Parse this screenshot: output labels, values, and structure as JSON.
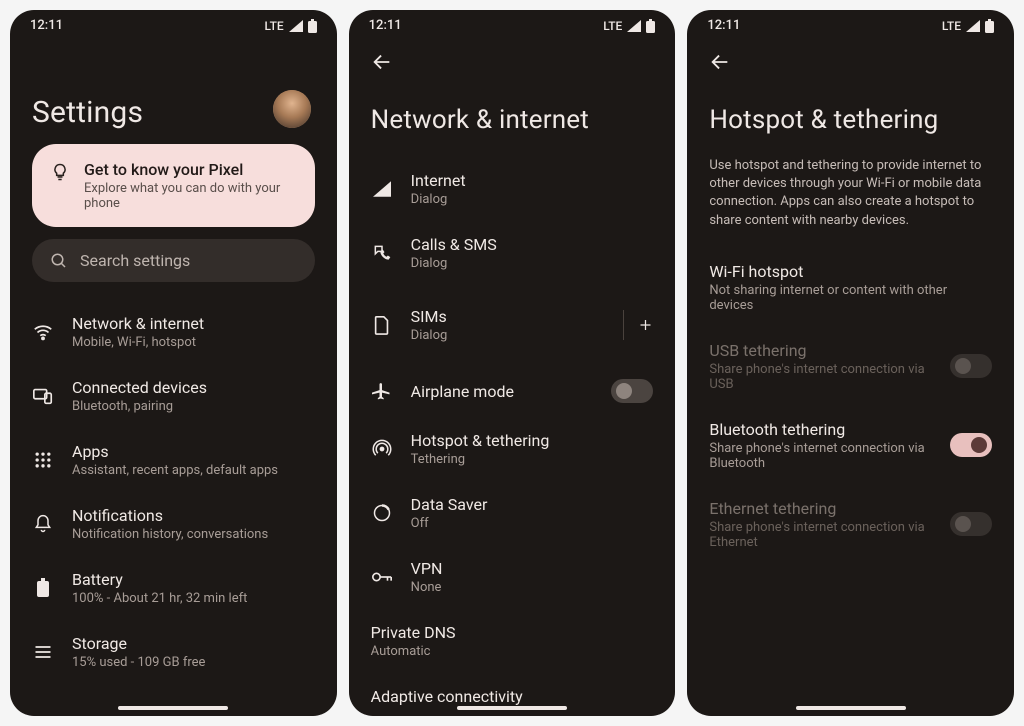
{
  "status": {
    "time": "12:11",
    "net": "LTE"
  },
  "screen1": {
    "title": "Settings",
    "promo": {
      "title": "Get to know your Pixel",
      "sub": "Explore what you can do with your phone"
    },
    "search_placeholder": "Search settings",
    "items": [
      {
        "title": "Network & internet",
        "sub": "Mobile, Wi-Fi, hotspot"
      },
      {
        "title": "Connected devices",
        "sub": "Bluetooth, pairing"
      },
      {
        "title": "Apps",
        "sub": "Assistant, recent apps, default apps"
      },
      {
        "title": "Notifications",
        "sub": "Notification history, conversations"
      },
      {
        "title": "Battery",
        "sub": "100% - About 21 hr, 32 min left"
      },
      {
        "title": "Storage",
        "sub": "15% used - 109 GB free"
      }
    ]
  },
  "screen2": {
    "title": "Network & internet",
    "items": [
      {
        "title": "Internet",
        "sub": "Dialog"
      },
      {
        "title": "Calls & SMS",
        "sub": "Dialog"
      },
      {
        "title": "SIMs",
        "sub": "Dialog"
      },
      {
        "title": "Airplane mode",
        "sub": ""
      },
      {
        "title": "Hotspot & tethering",
        "sub": "Tethering"
      },
      {
        "title": "Data Saver",
        "sub": "Off"
      },
      {
        "title": "VPN",
        "sub": "None"
      }
    ],
    "private_dns": {
      "title": "Private DNS",
      "sub": "Automatic"
    },
    "adaptive": {
      "title": "Adaptive connectivity"
    }
  },
  "screen3": {
    "title": "Hotspot & tethering",
    "desc": "Use hotspot and tethering to provide internet to other devices through your Wi-Fi or mobile data connection. Apps can also create a hotspot to share content with nearby devices.",
    "items": [
      {
        "title": "Wi-Fi hotspot",
        "sub": "Not sharing internet or content with other devices",
        "toggle": null,
        "enabled": true
      },
      {
        "title": "USB tethering",
        "sub": "Share phone's internet connection via USB",
        "toggle": false,
        "enabled": false
      },
      {
        "title": "Bluetooth tethering",
        "sub": "Share phone's internet connection via Bluetooth",
        "toggle": true,
        "enabled": true
      },
      {
        "title": "Ethernet tethering",
        "sub": "Share phone's internet connection via Ethernet",
        "toggle": false,
        "enabled": false
      }
    ]
  }
}
